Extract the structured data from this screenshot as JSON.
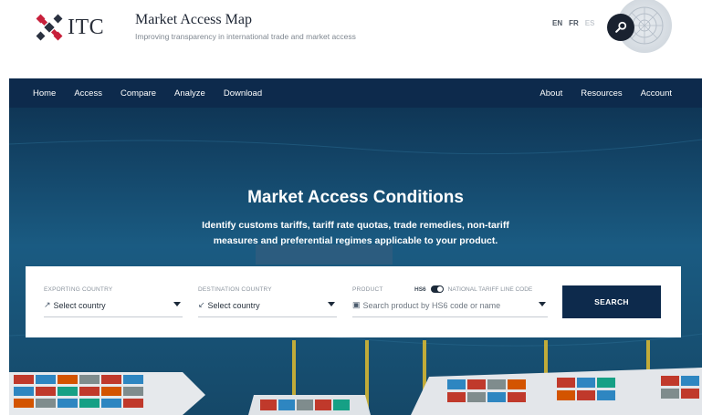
{
  "header": {
    "logo_text": "ITC",
    "title": "Market Access Map",
    "subtitle": "Improving transparency in international trade and market access",
    "languages": [
      {
        "code": "EN",
        "active": true
      },
      {
        "code": "FR",
        "active": false
      },
      {
        "code": "ES",
        "active": false
      }
    ],
    "search_icon": "magnifier-icon"
  },
  "nav": {
    "left": [
      "Home",
      "Access",
      "Compare",
      "Analyze",
      "Download"
    ],
    "right": [
      "About",
      "Resources",
      "Account"
    ]
  },
  "hero": {
    "title": "Market Access Conditions",
    "description": "Identify customs tariffs, tariff rate quotas, trade remedies, non-tariff measures and preferential regimes applicable to your product."
  },
  "search": {
    "exporting": {
      "label": "EXPORTING COUNTRY",
      "value": "Select country",
      "icon": "export-icon"
    },
    "destination": {
      "label": "DESTINATION COUNTRY",
      "value": "Select country",
      "icon": "import-icon"
    },
    "product": {
      "label": "PRODUCT",
      "hs6_label": "HS6",
      "ntl_label": "NATIONAL TARIFF LINE CODE",
      "placeholder": "Search product by HS6 code or name",
      "icon": "box-icon"
    },
    "button_label": "SEARCH"
  },
  "colors": {
    "navy": "#0d2a4c",
    "ocean": "#17527a",
    "text_muted": "#8a939d"
  }
}
